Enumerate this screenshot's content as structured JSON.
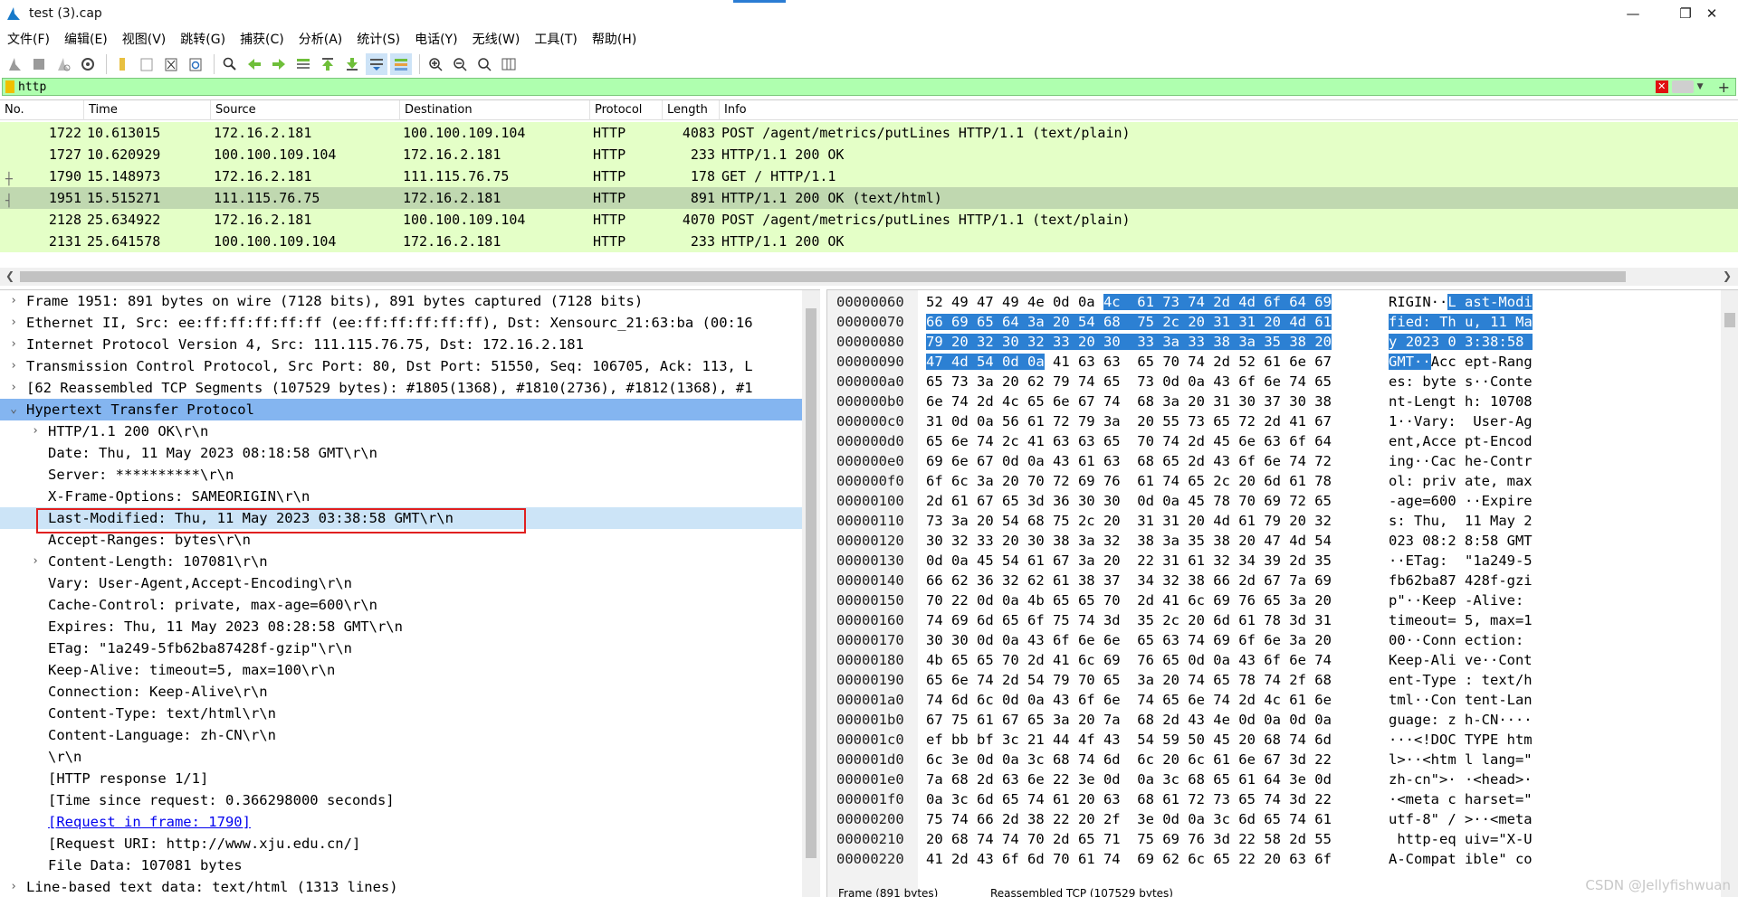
{
  "window": {
    "title": "test (3).cap"
  },
  "menu": [
    "文件(F)",
    "编辑(E)",
    "视图(V)",
    "跳转(G)",
    "捕获(C)",
    "分析(A)",
    "统计(S)",
    "电话(Y)",
    "无线(W)",
    "工具(T)",
    "帮助(H)"
  ],
  "filter": {
    "text": "http"
  },
  "packet_list": {
    "columns": [
      "No.",
      "Time",
      "Source",
      "Destination",
      "Protocol",
      "Length",
      "Info"
    ],
    "rows": [
      {
        "no": "1722",
        "time": "10.613015",
        "source": "172.16.2.181",
        "destination": "100.100.109.104",
        "protocol": "HTTP",
        "length": "4083",
        "info": "POST /agent/metrics/putLines HTTP/1.1  (text/plain)"
      },
      {
        "no": "1727",
        "time": "10.620929",
        "source": "100.100.109.104",
        "destination": "172.16.2.181",
        "protocol": "HTTP",
        "length": "233",
        "info": "HTTP/1.1 200 OK"
      },
      {
        "no": "1790",
        "time": "15.148973",
        "source": "172.16.2.181",
        "destination": "111.115.76.75",
        "protocol": "HTTP",
        "length": "178",
        "info": "GET / HTTP/1.1"
      },
      {
        "no": "1951",
        "time": "15.515271",
        "source": "111.115.76.75",
        "destination": "172.16.2.181",
        "protocol": "HTTP",
        "length": "891",
        "info": "HTTP/1.1 200 OK  (text/html)"
      },
      {
        "no": "2128",
        "time": "25.634922",
        "source": "172.16.2.181",
        "destination": "100.100.109.104",
        "protocol": "HTTP",
        "length": "4070",
        "info": "POST /agent/metrics/putLines HTTP/1.1  (text/plain)"
      },
      {
        "no": "2131",
        "time": "25.641578",
        "source": "100.100.109.104",
        "destination": "172.16.2.181",
        "protocol": "HTTP",
        "length": "233",
        "info": "HTTP/1.1 200 OK"
      }
    ]
  },
  "details": [
    {
      "text": "Frame 1951: 891 bytes on wire (7128 bits), 891 bytes captured (7128 bits)",
      "indent": 0,
      "exp": ">"
    },
    {
      "text": "Ethernet II, Src: ee:ff:ff:ff:ff:ff (ee:ff:ff:ff:ff:ff), Dst: Xensourc_21:63:ba (00:16",
      "indent": 0,
      "exp": ">"
    },
    {
      "text": "Internet Protocol Version 4, Src: 111.115.76.75, Dst: 172.16.2.181",
      "indent": 0,
      "exp": ">"
    },
    {
      "text": "Transmission Control Protocol, Src Port: 80, Dst Port: 51550, Seq: 106705, Ack: 113, L",
      "indent": 0,
      "exp": ">"
    },
    {
      "text": "[62 Reassembled TCP Segments (107529 bytes): #1805(1368), #1810(2736), #1812(1368), #1",
      "indent": 0,
      "exp": ">"
    },
    {
      "text": "Hypertext Transfer Protocol",
      "indent": 0,
      "exp": "v"
    },
    {
      "text": "HTTP/1.1 200 OK\\r\\n",
      "indent": 1,
      "exp": ">"
    },
    {
      "text": "Date: Thu, 11 May 2023 08:18:58 GMT\\r\\n",
      "indent": 1,
      "exp": ""
    },
    {
      "text": "Server: **********\\r\\n",
      "indent": 1,
      "exp": ""
    },
    {
      "text": "X-Frame-Options: SAMEORIGIN\\r\\n",
      "indent": 1,
      "exp": ""
    },
    {
      "text": "Last-Modified: Thu, 11 May 2023 03:38:58 GMT\\r\\n",
      "indent": 1,
      "exp": ""
    },
    {
      "text": "Accept-Ranges: bytes\\r\\n",
      "indent": 1,
      "exp": ""
    },
    {
      "text": "Content-Length: 107081\\r\\n",
      "indent": 1,
      "exp": ">"
    },
    {
      "text": "Vary: User-Agent,Accept-Encoding\\r\\n",
      "indent": 1,
      "exp": ""
    },
    {
      "text": "Cache-Control: private, max-age=600\\r\\n",
      "indent": 1,
      "exp": ""
    },
    {
      "text": "Expires: Thu, 11 May 2023 08:28:58 GMT\\r\\n",
      "indent": 1,
      "exp": ""
    },
    {
      "text": "ETag: \"1a249-5fb62ba87428f-gzip\"\\r\\n",
      "indent": 1,
      "exp": ""
    },
    {
      "text": "Keep-Alive: timeout=5, max=100\\r\\n",
      "indent": 1,
      "exp": ""
    },
    {
      "text": "Connection: Keep-Alive\\r\\n",
      "indent": 1,
      "exp": ""
    },
    {
      "text": "Content-Type: text/html\\r\\n",
      "indent": 1,
      "exp": ""
    },
    {
      "text": "Content-Language: zh-CN\\r\\n",
      "indent": 1,
      "exp": ""
    },
    {
      "text": "\\r\\n",
      "indent": 1,
      "exp": ""
    },
    {
      "text": "[HTTP response 1/1]",
      "indent": 1,
      "exp": ""
    },
    {
      "text": "[Time since request: 0.366298000 seconds]",
      "indent": 1,
      "exp": ""
    },
    {
      "text": "[Request in frame: 1790]",
      "indent": 1,
      "exp": "",
      "link": true
    },
    {
      "text": "[Request URI: http://www.xju.edu.cn/]",
      "indent": 1,
      "exp": ""
    },
    {
      "text": "File Data: 107081 bytes",
      "indent": 1,
      "exp": ""
    },
    {
      "text": "Line-based text data: text/html (1313 lines)",
      "indent": 0,
      "exp": ">"
    }
  ],
  "bytes": [
    {
      "off": "00000060",
      "hex": "52 49 47 49 4e 0d 0a 4c  61 73 74 2d 4d 6f 64 69",
      "asc": "RIGIN··L ast-Modi"
    },
    {
      "off": "00000070",
      "hex": "66 69 65 64 3a 20 54 68  75 2c 20 31 31 20 4d 61",
      "asc": "fied: Th u, 11 Ma"
    },
    {
      "off": "00000080",
      "hex": "79 20 32 30 32 33 20 30  33 3a 33 38 3a 35 38 20",
      "asc": "y 2023 0 3:38:58 "
    },
    {
      "off": "00000090",
      "hex": "47 4d 54 0d 0a 41 63 63  65 70 74 2d 52 61 6e 67",
      "asc": "GMT··Acc ept-Rang"
    },
    {
      "off": "000000a0",
      "hex": "65 73 3a 20 62 79 74 65  73 0d 0a 43 6f 6e 74 65",
      "asc": "es: byte s··Conte"
    },
    {
      "off": "000000b0",
      "hex": "6e 74 2d 4c 65 6e 67 74  68 3a 20 31 30 37 30 38",
      "asc": "nt-Lengt h: 10708"
    },
    {
      "off": "000000c0",
      "hex": "31 0d 0a 56 61 72 79 3a  20 55 73 65 72 2d 41 67",
      "asc": "1··Vary:  User-Ag"
    },
    {
      "off": "000000d0",
      "hex": "65 6e 74 2c 41 63 63 65  70 74 2d 45 6e 63 6f 64",
      "asc": "ent,Acce pt-Encod"
    },
    {
      "off": "000000e0",
      "hex": "69 6e 67 0d 0a 43 61 63  68 65 2d 43 6f 6e 74 72",
      "asc": "ing··Cac he-Contr"
    },
    {
      "off": "000000f0",
      "hex": "6f 6c 3a 20 70 72 69 76  61 74 65 2c 20 6d 61 78",
      "asc": "ol: priv ate, max"
    },
    {
      "off": "00000100",
      "hex": "2d 61 67 65 3d 36 30 30  0d 0a 45 78 70 69 72 65",
      "asc": "-age=600 ··Expire"
    },
    {
      "off": "00000110",
      "hex": "73 3a 20 54 68 75 2c 20  31 31 20 4d 61 79 20 32",
      "asc": "s: Thu,  11 May 2"
    },
    {
      "off": "00000120",
      "hex": "30 32 33 20 30 38 3a 32  38 3a 35 38 20 47 4d 54",
      "asc": "023 08:2 8:58 GMT"
    },
    {
      "off": "00000130",
      "hex": "0d 0a 45 54 61 67 3a 20  22 31 61 32 34 39 2d 35",
      "asc": "··ETag:  \"1a249-5"
    },
    {
      "off": "00000140",
      "hex": "66 62 36 32 62 61 38 37  34 32 38 66 2d 67 7a 69",
      "asc": "fb62ba87 428f-gzi"
    },
    {
      "off": "00000150",
      "hex": "70 22 0d 0a 4b 65 65 70  2d 41 6c 69 76 65 3a 20",
      "asc": "p\"··Keep -Alive: "
    },
    {
      "off": "00000160",
      "hex": "74 69 6d 65 6f 75 74 3d  35 2c 20 6d 61 78 3d 31",
      "asc": "timeout= 5, max=1"
    },
    {
      "off": "00000170",
      "hex": "30 30 0d 0a 43 6f 6e 6e  65 63 74 69 6f 6e 3a 20",
      "asc": "00··Conn ection: "
    },
    {
      "off": "00000180",
      "hex": "4b 65 65 70 2d 41 6c 69  76 65 0d 0a 43 6f 6e 74",
      "asc": "Keep-Ali ve··Cont"
    },
    {
      "off": "00000190",
      "hex": "65 6e 74 2d 54 79 70 65  3a 20 74 65 78 74 2f 68",
      "asc": "ent-Type : text/h"
    },
    {
      "off": "000001a0",
      "hex": "74 6d 6c 0d 0a 43 6f 6e  74 65 6e 74 2d 4c 61 6e",
      "asc": "tml··Con tent-Lan"
    },
    {
      "off": "000001b0",
      "hex": "67 75 61 67 65 3a 20 7a  68 2d 43 4e 0d 0a 0d 0a",
      "asc": "guage: z h-CN····"
    },
    {
      "off": "000001c0",
      "hex": "ef bb bf 3c 21 44 4f 43  54 59 50 45 20 68 74 6d",
      "asc": "···<!DOC TYPE htm"
    },
    {
      "off": "000001d0",
      "hex": "6c 3e 0d 0a 3c 68 74 6d  6c 20 6c 61 6e 67 3d 22",
      "asc": "l>··<htm l lang=\""
    },
    {
      "off": "000001e0",
      "hex": "7a 68 2d 63 6e 22 3e 0d  0a 3c 68 65 61 64 3e 0d",
      "asc": "zh-cn\">· ·<head>·"
    },
    {
      "off": "000001f0",
      "hex": "0a 3c 6d 65 74 61 20 63  68 61 72 73 65 74 3d 22",
      "asc": "·<meta c harset=\""
    },
    {
      "off": "00000200",
      "hex": "75 74 66 2d 38 22 20 2f  3e 0d 0a 3c 6d 65 74 61",
      "asc": "utf-8\" / >··<meta"
    },
    {
      "off": "00000210",
      "hex": "20 68 74 74 70 2d 65 71  75 69 76 3d 22 58 2d 55",
      "asc": " http-eq uiv=\"X-U"
    },
    {
      "off": "00000220",
      "hex": "41 2d 43 6f 6d 70 61 74  69 62 6c 65 22 20 63 6f",
      "asc": "A-Compat ible\" co"
    }
  ],
  "bytes_tabs": [
    "Frame (891 bytes)",
    "Reassembled TCP (107529 bytes)"
  ],
  "watermark": "CSDN @Jellyfishwuan"
}
